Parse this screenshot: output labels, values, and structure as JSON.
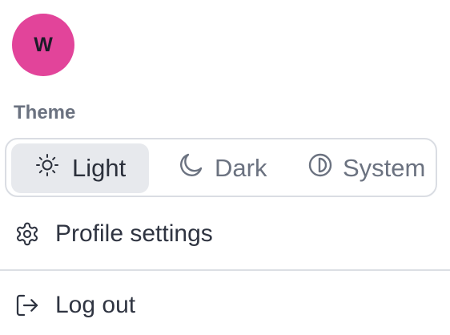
{
  "user": {
    "avatar_initial": "W",
    "avatar_color": "#e2449a"
  },
  "theme": {
    "section_label": "Theme",
    "selected": "Light",
    "options": [
      {
        "label": "Light",
        "icon": "sun-icon"
      },
      {
        "label": "Dark",
        "icon": "moon-icon"
      },
      {
        "label": "System",
        "icon": "half-circle-icon"
      }
    ]
  },
  "menu": {
    "items": [
      {
        "label": "Profile settings",
        "icon": "gear-icon"
      },
      {
        "label": "Log out",
        "icon": "logout-icon"
      }
    ]
  }
}
